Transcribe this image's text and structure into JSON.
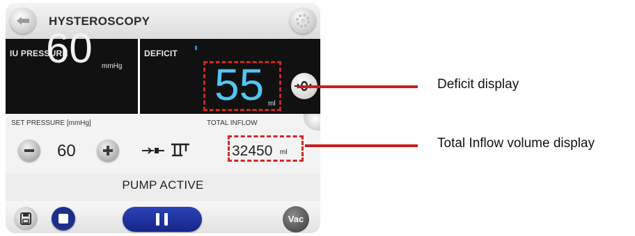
{
  "header": {
    "title": "HYSTEROSCOPY"
  },
  "iu_pressure": {
    "label": "IU PRESSURE",
    "value": "60",
    "unit": "mmHg"
  },
  "deficit": {
    "label": "DEFICIT",
    "value": "55",
    "unit": "ml",
    "value_color": "#4fc6f2"
  },
  "set_pressure": {
    "label": "SET PRESSURE [mmHg]",
    "value": "60"
  },
  "total_inflow": {
    "label": "TOTAL INFLOW",
    "value": "32450",
    "unit": "ml"
  },
  "status": {
    "text": "PUMP ACTIVE"
  },
  "controls": {
    "vac_label": "Vac"
  },
  "callouts": [
    {
      "text": "Deficit display"
    },
    {
      "text": "Total Inflow volume display"
    }
  ],
  "colors": {
    "highlight": "#d42424",
    "primary_button": "#1d2f8a"
  },
  "icons": [
    "back-arrow-icon",
    "gear-icon",
    "zero-reset-icon",
    "minus-icon",
    "plus-icon",
    "tubing-connector-icon",
    "pump-mode-icon",
    "save-icon",
    "stop-icon",
    "pause-icon"
  ]
}
